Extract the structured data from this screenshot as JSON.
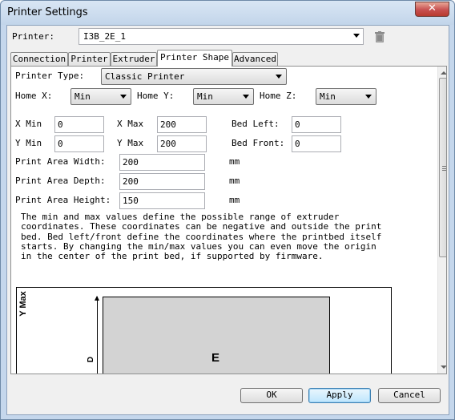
{
  "window": {
    "title": "Printer Settings",
    "close_glyph": "✕"
  },
  "printer": {
    "label": "Printer:",
    "value": "I3B_2E_1",
    "delete_icon": "trash-icon"
  },
  "tabs": [
    "Connection",
    "Printer",
    "Extruder",
    "Printer Shape",
    "Advanced"
  ],
  "active_tab": "Printer Shape",
  "shape": {
    "printer_type_label": "Printer Type:",
    "printer_type_value": "Classic Printer",
    "home_x_label": "Home X:",
    "home_x_value": "Min",
    "home_y_label": "Home Y:",
    "home_y_value": "Min",
    "home_z_label": "Home Z:",
    "home_z_value": "Min",
    "x_min_label": "X Min",
    "x_min_value": "0",
    "x_max_label": "X Max",
    "x_max_value": "200",
    "bed_left_label": "Bed Left:",
    "bed_left_value": "0",
    "y_min_label": "Y Min",
    "y_min_value": "0",
    "y_max_label": "Y Max",
    "y_max_value": "200",
    "bed_front_label": "Bed Front:",
    "bed_front_value": "0",
    "width_label": "Print Area Width:",
    "width_value": "200",
    "width_unit": "mm",
    "depth_label": "Print Area Depth:",
    "depth_value": "200",
    "depth_unit": "mm",
    "height_label": "Print Area Height:",
    "height_value": "150",
    "height_unit": "mm",
    "description": "The min and max values define the possible range of extruder coordinates. These coordinates can be negative and outside the print bed. Bed left/front define the coordinates where the printbed itself starts. By changing the min/max values you can even move the origin in the center of the print bed, if supported by firmware."
  },
  "diagram": {
    "y_axis_label": "Y Max",
    "bed_label": "E",
    "depth_dim_label": "D"
  },
  "buttons": {
    "ok": "OK",
    "apply": "Apply",
    "cancel": "Cancel"
  }
}
